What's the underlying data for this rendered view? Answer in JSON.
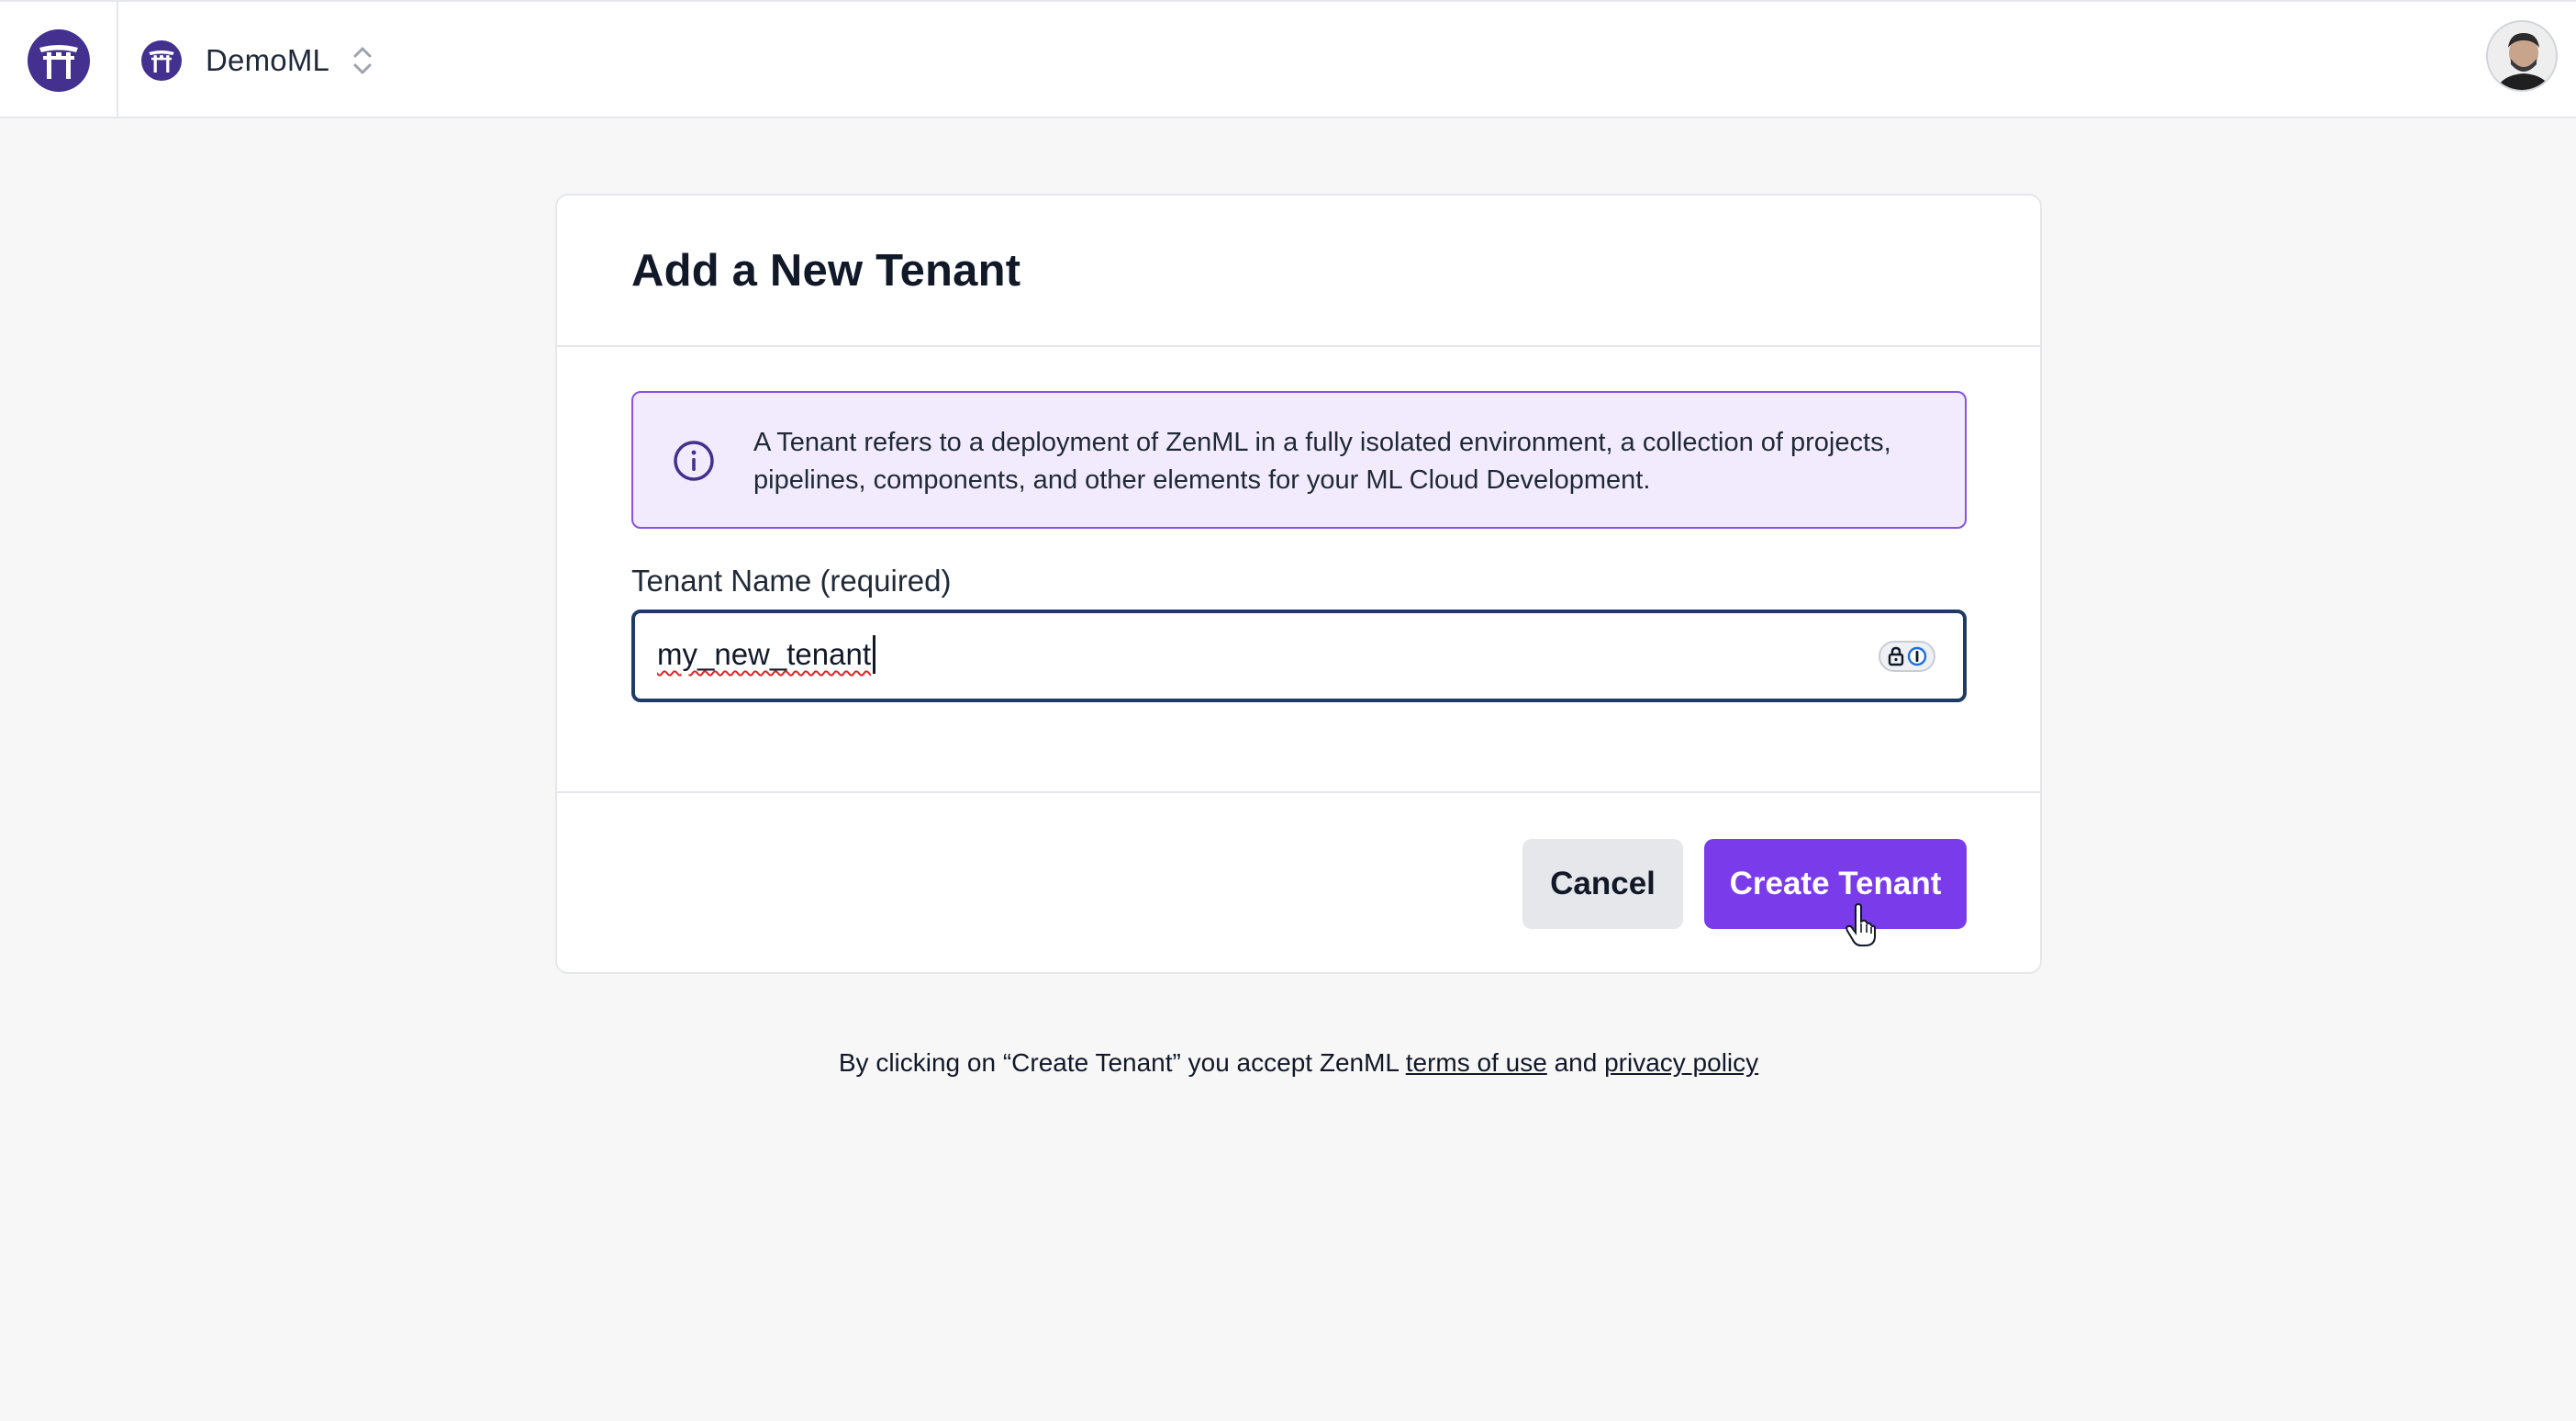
{
  "topbar": {
    "tenant_name": "DemoML",
    "icons": [
      "zenml-logo-icon",
      "tenant-logo-icon",
      "chevron-updown-icon",
      "user-avatar"
    ]
  },
  "card": {
    "title": "Add a New Tenant",
    "info": {
      "icon": "info-icon",
      "text": "A Tenant refers to a deployment of ZenML in a fully isolated environment, a collection of projects, pipelines, components, and other elements for your ML Cloud Development."
    },
    "field": {
      "label": "Tenant Name (required)",
      "value": "my_new_tenant",
      "password_manager_icon": "password-manager-icon"
    },
    "buttons": {
      "cancel": "Cancel",
      "create": "Create Tenant"
    }
  },
  "legal": {
    "prefix": "By clicking on “Create Tenant” you accept ZenML",
    "terms_link": "terms of use",
    "middle": "and",
    "privacy_link": "privacy policy"
  },
  "colors": {
    "brand_purple": "#7a3bea",
    "logo_purple": "#43308f",
    "info_bg": "#f1ebfd",
    "info_border": "#8a52e0",
    "input_focus_border": "#1f3a66"
  }
}
